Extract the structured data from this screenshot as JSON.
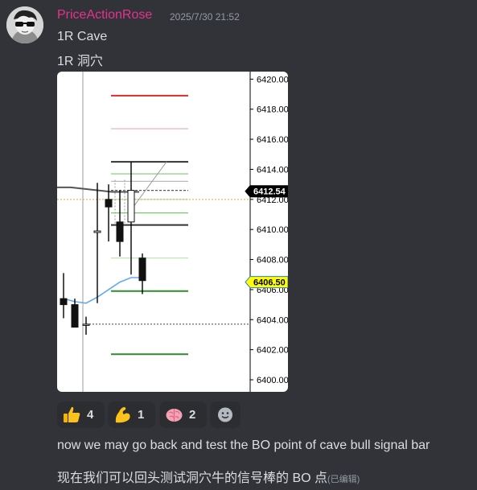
{
  "message": {
    "username": "PriceActionRose",
    "timestamp": "2025/7/30 21:52",
    "lines": [
      "1R Cave",
      "1R 洞穴"
    ],
    "reply_en": "now we may go back and test the BO point of cave bull  signal bar",
    "reply_zh": "现在我们可以回头测试洞穴牛的信号棒的 BO 点",
    "edited_label": "(已编辑)"
  },
  "reactions": [
    {
      "icon": "thumbs-up-icon",
      "count": "4"
    },
    {
      "icon": "flexed-biceps-icon",
      "count": "1"
    },
    {
      "icon": "brain-icon",
      "count": "2"
    }
  ],
  "add_reaction_icon": "smiley-add-icon",
  "chart_data": {
    "type": "candlestick",
    "y_tick_labels": [
      "6420.00",
      "6418.00",
      "6416.00",
      "6414.00",
      "6412.00",
      "6410.00",
      "6408.00",
      "6406.00",
      "6404.00",
      "6402.00",
      "6400.00"
    ],
    "y_ticks": [
      6420,
      6418,
      6416,
      6414,
      6412,
      6410,
      6408,
      6406,
      6404,
      6402,
      6400
    ],
    "ylim": [
      6399.2,
      6420.5
    ],
    "price_labels": [
      {
        "text": "6412.54",
        "value": 6412.54,
        "color": "#000000",
        "textColor": "#ffffff"
      },
      {
        "text": "6406.50",
        "value": 6406.5,
        "color": "#ffff00",
        "textColor": "#000000"
      }
    ],
    "candles": [
      {
        "o": 6405.4,
        "h": 6407.1,
        "l": 6404.1,
        "c": 6405.0
      },
      {
        "o": 6405.0,
        "h": 6405.4,
        "l": 6403.9,
        "c": 6403.5
      },
      {
        "o": 6403.7,
        "h": 6404.2,
        "l": 6403.0,
        "c": 6403.7
      },
      {
        "o": 6409.8,
        "h": 6413.1,
        "l": 6405.1,
        "c": 6409.9
      },
      {
        "o": 6412.0,
        "h": 6413.0,
        "l": 6409.2,
        "c": 6411.5
      },
      {
        "o": 6410.5,
        "h": 6412.6,
        "l": 6408.2,
        "c": 6409.2
      },
      {
        "o": 6410.5,
        "h": 6414.5,
        "l": 6407.0,
        "c": 6412.6
      },
      {
        "o": 6408.1,
        "h": 6408.4,
        "l": 6405.7,
        "c": 6406.6
      }
    ],
    "levels": [
      {
        "value": 6418.9,
        "color": "#d32f2f",
        "style": "solid"
      },
      {
        "value": 6416.7,
        "color": "#f5b5b5",
        "style": "solid"
      },
      {
        "value": 6414.5,
        "color": "#333333",
        "style": "solid"
      },
      {
        "value": 6413.7,
        "color": "#7bc96f",
        "style": "solid"
      },
      {
        "value": 6413.2,
        "color": "#bbbbbb",
        "style": "solid"
      },
      {
        "value": 6412.6,
        "color": "#555555",
        "style": "dashed"
      },
      {
        "value": 6412.0,
        "color": "#b8e3b0",
        "style": "solid"
      },
      {
        "value": 6411.1,
        "color": "#7bc96f",
        "style": "solid"
      },
      {
        "value": 6410.3,
        "color": "#333333",
        "style": "solid"
      },
      {
        "value": 6408.1,
        "color": "#b8e3b0",
        "style": "solid"
      },
      {
        "value": 6405.9,
        "color": "#2e8b2e",
        "style": "solid"
      },
      {
        "value": 6401.7,
        "color": "#2e8b2e",
        "style": "solid"
      }
    ],
    "orange_level": 6412.0,
    "dotted_level": 6403.7,
    "moving_average_blue": [
      6405.4,
      6405.2,
      6405.1,
      6405.5,
      6406.0,
      6406.5,
      6406.8,
      6406.8
    ],
    "moving_average_gray": [
      6412.8,
      6412.8,
      6412.7,
      6412.6,
      6412.5,
      6412.5,
      6412.5
    ]
  }
}
